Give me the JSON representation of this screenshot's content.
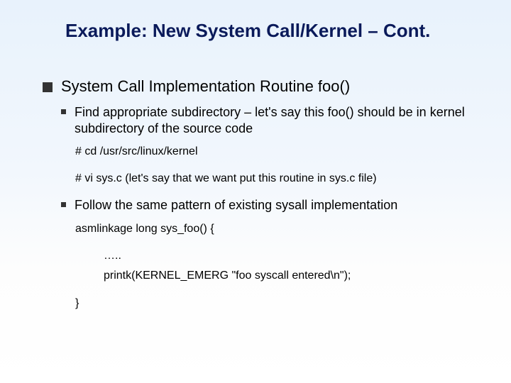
{
  "title": "Example: New System Call/Kernel – Cont.",
  "bullet1": {
    "text": "System Call Implementation Routine foo()"
  },
  "sub1": {
    "text": "Find appropriate subdirectory – let's say this foo() should be in kernel subdirectory of the source code",
    "code_line1": "# cd /usr/src/linux/kernel",
    "code_line2": " # vi sys.c  (let's say that we want put this routine in sys.c file)"
  },
  "sub2": {
    "text": "Follow the same pattern of existing sysall implementation",
    "code_line1": "asmlinkage long sys_foo() {",
    "code_line2": "…..",
    "code_line3": "printk(KERNEL_EMERG \"foo syscall entered\\n\");",
    "code_close": "}"
  }
}
